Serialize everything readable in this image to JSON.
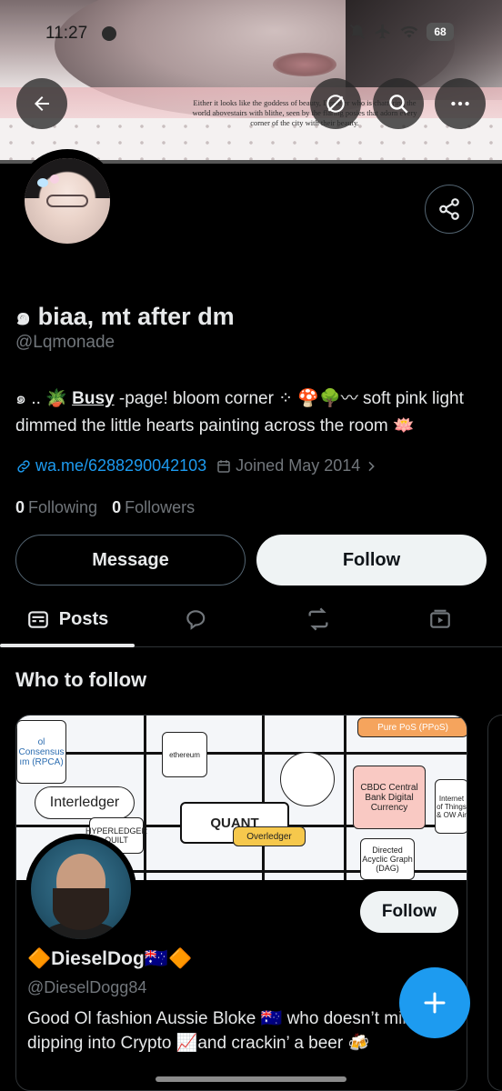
{
  "status_bar": {
    "time": "11:27",
    "battery": "68"
  },
  "banner": {
    "quote": "Either it looks like the goddess of beauty, Demeter who is chattering the world abovestairs with blithe, seen by the flaring posies that adorn every corner of the city with their beauty."
  },
  "profile": {
    "name": "๑ biaa, mt after dm",
    "handle": "@Lqmonade",
    "bio_prefix": "๑ .. 🪴 ",
    "bio_busy": "Busy",
    "bio_rest": " -page! bloom corner ⁘ 🍄🌳〰 soft pink light dimmed the little hearts painting across the room 🪷",
    "link": "wa.me/6288290042103",
    "joined": "Joined May 2014",
    "following_count": "0",
    "following_label": "Following",
    "followers_count": "0",
    "followers_label": "Followers"
  },
  "actions": {
    "message": "Message",
    "follow": "Follow"
  },
  "tabs": {
    "posts": "Posts"
  },
  "who_to_follow": {
    "title": "Who to follow",
    "card": {
      "name": "🔶DieselDog🇦🇺🔶",
      "handle": "@DieselDogg84",
      "bio": "Good Ol fashion Aussie Bloke 🇦🇺 who doesn’t mind dipping into Crypto 📈and crackin’ a beer 🍻",
      "follow": "Follow",
      "banner_labels": {
        "interledger": "Interledger",
        "quant": "QUANT",
        "overledger": "Overledger",
        "cbdc": "CBDC Central Bank Digital Currency",
        "dag": "Directed Acyclic Graph (DAG)",
        "pos": "Pure PoS (PPoS)",
        "quilt": "HYPERLEDGER QUILT",
        "ethereum": "ethereum",
        "consensus": "ol Consensus ım (RPCA)",
        "iot": "Internet of Things & OW Air"
      }
    }
  },
  "colors": {
    "accent": "#1d9bf0",
    "background": "#000000",
    "text_primary": "#e7e9ea",
    "text_secondary": "#71767b",
    "border": "#2f3336"
  },
  "icons": {
    "back": "arrow-left-icon",
    "mute": "eye-off-icon",
    "search": "search-icon",
    "more": "more-horizontal-icon",
    "share": "share-icon",
    "link": "link-icon",
    "calendar": "calendar-icon",
    "chevron": "chevron-right-icon",
    "posts": "posts-icon",
    "replies": "reply-bubble-icon",
    "reposts": "repost-icon",
    "media": "media-icon",
    "compose": "plus-icon"
  }
}
